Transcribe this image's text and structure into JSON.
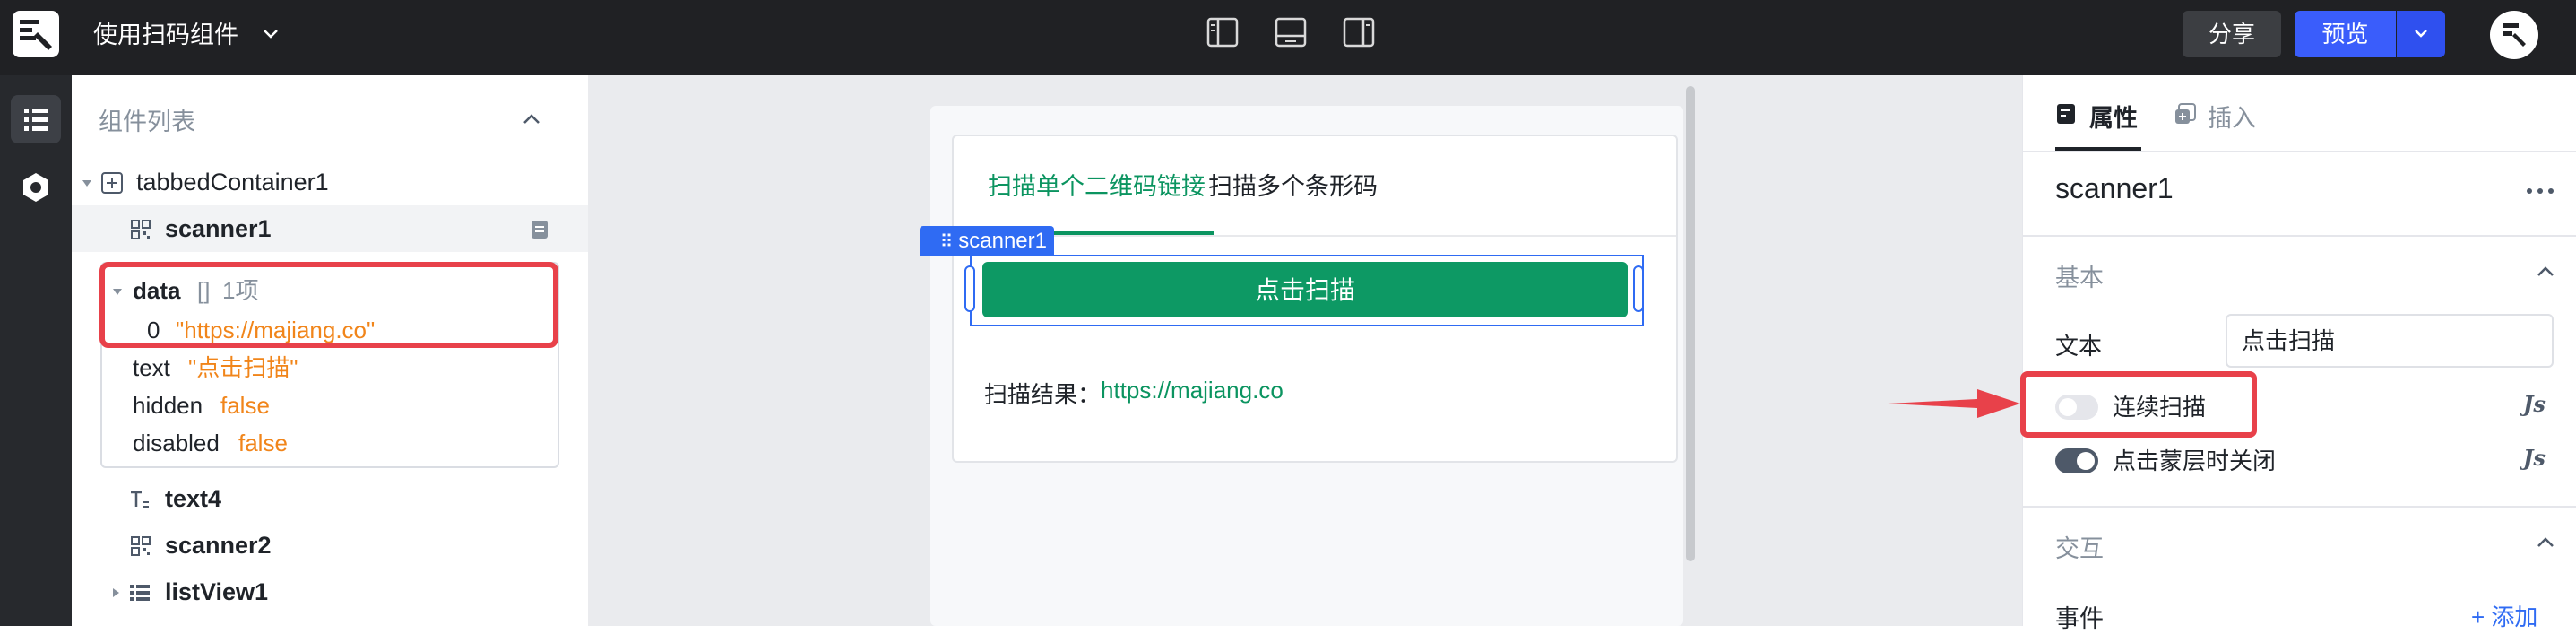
{
  "app": {
    "title": "使用扫码组件",
    "share_label": "分享",
    "preview_label": "预览"
  },
  "left_panel": {
    "title": "组件列表",
    "tree": [
      {
        "name": "tabbedContainer1",
        "icon": "tabbed-container-icon"
      },
      {
        "name": "scanner1",
        "icon": "qr-icon",
        "selected": true
      },
      {
        "name": "text4",
        "icon": "text-icon"
      },
      {
        "name": "scanner2",
        "icon": "qr-icon"
      },
      {
        "name": "listView1",
        "icon": "list-icon"
      }
    ],
    "props": {
      "data_key": "data",
      "data_type": "[]",
      "data_count": "1项",
      "data_item_index": "0",
      "data_item_value": "\"https://majiang.co\"",
      "text_key": "text",
      "text_value": "\"点击扫描\"",
      "hidden_key": "hidden",
      "hidden_value": "false",
      "disabled_key": "disabled",
      "disabled_value": "false"
    }
  },
  "canvas": {
    "tabs": [
      "扫描单个二维码链接",
      "扫描多个条形码"
    ],
    "active_tab": 0,
    "selected_badge": "scanner1",
    "scan_button_label": "点击扫描",
    "result_label": "扫描结果：",
    "result_value": "https://majiang.co"
  },
  "right_panel": {
    "tabs": [
      "属性",
      "插入"
    ],
    "component_name": "scanner1",
    "section_basic": "基本",
    "text_label": "文本",
    "text_value": "点击扫描",
    "toggle_continuous_label": "连续扫描",
    "toggle_continuous_on": false,
    "toggle_close_label": "点击蒙层时关闭",
    "toggle_close_on": true,
    "js_badge": "Js",
    "section_interaction": "交互",
    "events_label": "事件",
    "add_label": "+ 添加"
  },
  "colors": {
    "accent_green": "#0d9964",
    "accent_blue": "#3a5dfb",
    "highlight_red": "#e8414a",
    "value_orange": "#f1851a"
  }
}
